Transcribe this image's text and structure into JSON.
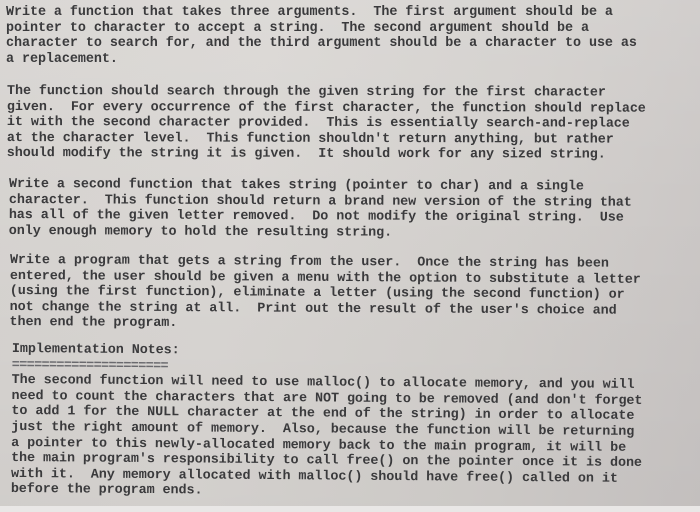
{
  "document": {
    "paragraphs": [
      {
        "lines": [
          "Write a function that takes three arguments.  The first argument should be a",
          "pointer to character to accept a string.  The second argument should be a",
          "character to search for, and the third argument should be a character to use as",
          "a replacement."
        ]
      },
      {
        "lines": [
          "The function should search through the given string for the first character",
          "given.  For every occurrence of the first character, the function should replace",
          "it with the second character provided.  This is essentially search-and-replace",
          "at the character level.  This function shouldn't return anything, but rather",
          "should modify the string it is given.  It should work for any sized string."
        ]
      },
      {
        "lines": [
          "Write a second function that takes string (pointer to char) and a single",
          "character.  This function should return a brand new version of the string that",
          "has all of the given letter removed.  Do not modify the original string.  Use",
          "only enough memory to hold the resulting string."
        ]
      },
      {
        "lines": [
          "Write a program that gets a string from the user.  Once the string has been",
          "entered, the user should be given a menu with the option to substitute a letter",
          "(using the first function), eliminate a letter (using the second function) or",
          "not change the string at all.  Print out the result of the user's choice and",
          "then end the program."
        ]
      }
    ],
    "notes": {
      "heading": "Implementation Notes:",
      "underline": "=====================",
      "lines": [
        "The second function will need to use malloc() to allocate memory, and you will",
        "need to count the characters that are NOT going to be removed (and don't forget",
        "to add 1 for the NULL character at the end of the string) in order to allocate",
        "just the right amount of memory.  Also, because the function will be returning",
        "a pointer to this newly-allocated memory back to the main program, it will be",
        "the main program's responsibility to call free() on the pointer once it is done",
        "with it.  Any memory allocated with malloc() should have free() called on it",
        "before the program ends."
      ]
    }
  }
}
